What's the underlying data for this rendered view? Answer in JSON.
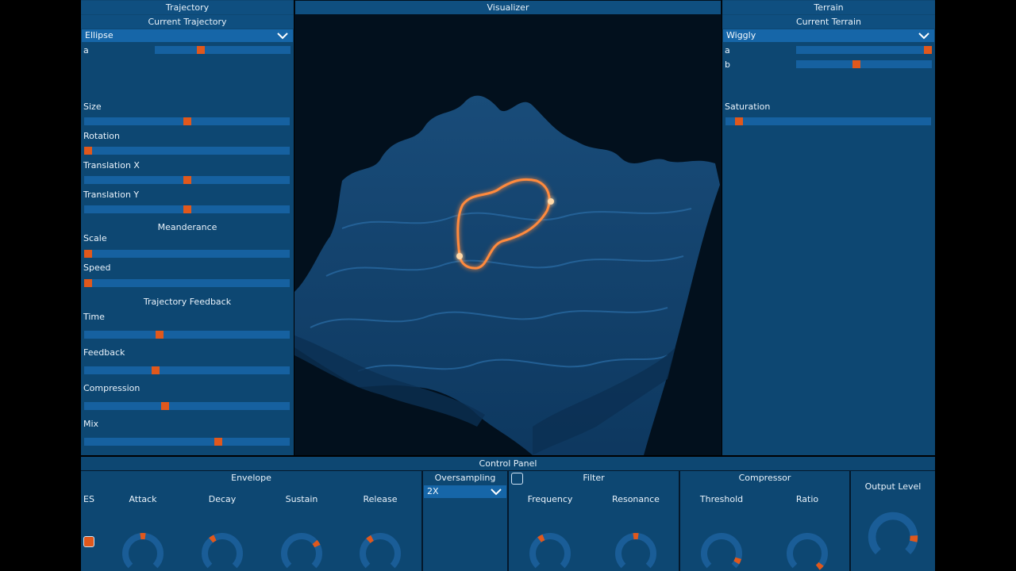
{
  "trajectory": {
    "title": "Trajectory",
    "current_label": "Current Trajectory",
    "selected": "Ellipse",
    "param_a_label": "a",
    "param_a_value": 0.33,
    "size": {
      "label": "Size",
      "value": 0.5
    },
    "rotation": {
      "label": "Rotation",
      "value": 0.0
    },
    "translation_x": {
      "label": "Translation X",
      "value": 0.5
    },
    "translation_y": {
      "label": "Translation Y",
      "value": 0.5
    },
    "meanderance": {
      "title": "Meanderance",
      "scale": {
        "label": "Scale",
        "value": 0.0
      },
      "speed": {
        "label": "Speed",
        "value": 0.0
      }
    },
    "feedback": {
      "title": "Trajectory Feedback",
      "time": {
        "label": "Time",
        "value": 0.36
      },
      "feedback": {
        "label": "Feedback",
        "value": 0.34
      },
      "compression": {
        "label": "Compression",
        "value": 0.39
      },
      "mix": {
        "label": "Mix",
        "value": 0.66
      }
    }
  },
  "visualizer": {
    "title": "Visualizer"
  },
  "terrain": {
    "title": "Terrain",
    "current_label": "Current Terrain",
    "selected": "Wiggly",
    "param_a_label": "a",
    "param_a_value": 1.0,
    "param_b_label": "b",
    "param_b_value": 0.44,
    "saturation": {
      "label": "Saturation",
      "value": 0.05
    }
  },
  "control_panel": {
    "title": "Control Panel",
    "envelope": {
      "title": "Envelope",
      "es_label": "ES",
      "attack": {
        "label": "Attack",
        "value": 0.5
      },
      "decay": {
        "label": "Decay",
        "value": 0.38
      },
      "sustain": {
        "label": "Sustain",
        "value": 0.71
      },
      "release": {
        "label": "Release",
        "value": 0.37
      }
    },
    "oversampling": {
      "title": "Oversampling",
      "selected": "2X"
    },
    "filter": {
      "title": "Filter",
      "frequency": {
        "label": "Frequency",
        "value": 0.39
      },
      "resonance": {
        "label": "Resonance",
        "value": 0.5
      }
    },
    "compressor": {
      "title": "Compressor",
      "threshold": {
        "label": "Threshold",
        "value": 0.92
      },
      "ratio": {
        "label": "Ratio",
        "value": 1.0
      }
    },
    "output_level": {
      "label": "Output Level",
      "value": 0.85
    }
  },
  "colors": {
    "panel": "#0d4772",
    "track": "#1661a0",
    "thumb": "#e0581c",
    "knob_track": "#1a5d97",
    "trajectory_glow": "#ff8a3c"
  }
}
